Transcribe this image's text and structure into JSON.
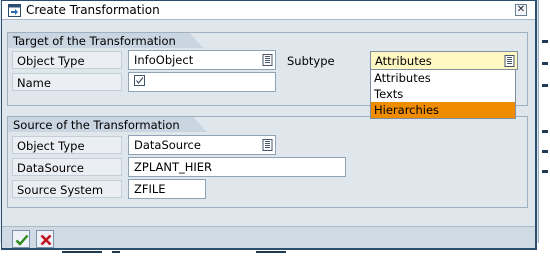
{
  "window": {
    "title": "Create Transformation"
  },
  "target_group": {
    "title": "Target of the Transformation",
    "object_type_label": "Object Type",
    "object_type_value": "InfoObject",
    "subtype_label": "Subtype",
    "subtype_value": "Attributes",
    "name_label": "Name",
    "subtype_options": [
      "Attributes",
      "Texts",
      "Hierarchies"
    ]
  },
  "source_group": {
    "title": "Source of the Transformation",
    "object_type_label": "Object Type",
    "object_type_value": "DataSource",
    "datasource_label": "DataSource",
    "datasource_value": "ZPLANT_HIER",
    "source_system_label": "Source System",
    "source_system_value": "ZFILE"
  },
  "toolbar": {
    "buttons": [
      "checkmark-icon",
      "cancel-icon"
    ]
  },
  "colors": {
    "highlight": "#f08c00",
    "selected_field": "#fff7c2",
    "frame": "#2b4d6e",
    "background": "#dfe6ec"
  }
}
